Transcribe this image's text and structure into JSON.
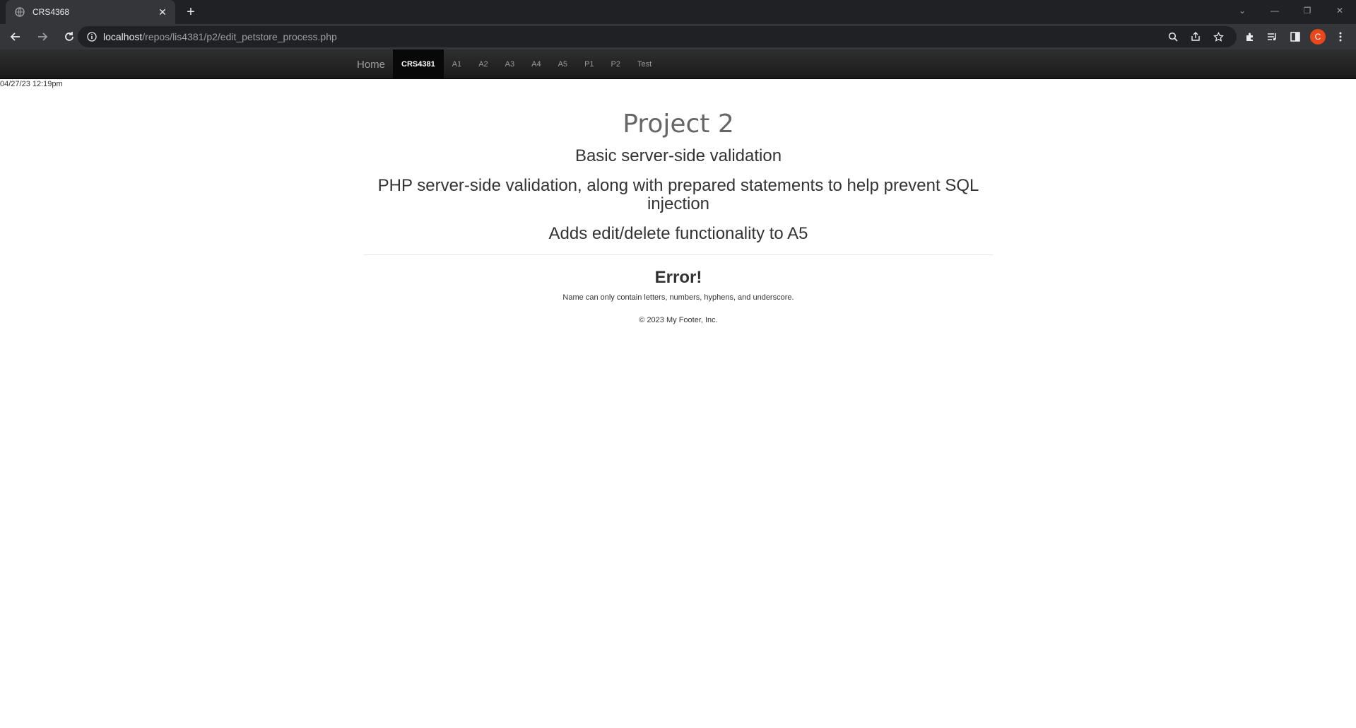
{
  "browser": {
    "tab_title": "CRS4368",
    "url_host": "localhost",
    "url_path": "/repos/lis4381/p2/edit_petstore_process.php",
    "profile_initial": "C",
    "icons": [
      "globe-icon",
      "close-icon",
      "plus-icon",
      "chevron-down-icon",
      "minimize-icon",
      "restore-icon",
      "back-icon",
      "forward-icon",
      "reload-icon",
      "info-icon",
      "zoom-icon",
      "share-icon",
      "star-icon",
      "extensions-icon",
      "media-icon",
      "side-panel-icon",
      "menu-icon"
    ]
  },
  "nav": {
    "brand": "Home",
    "items": [
      {
        "label": "CRS4381",
        "active": true
      },
      {
        "label": "A1"
      },
      {
        "label": "A2"
      },
      {
        "label": "A3"
      },
      {
        "label": "A4"
      },
      {
        "label": "A5"
      },
      {
        "label": "P1"
      },
      {
        "label": "P2"
      },
      {
        "label": "Test"
      }
    ]
  },
  "timestamp": "04/27/23 12:19pm",
  "main": {
    "title": "Project 2",
    "lines": [
      "Basic server-side validation",
      "PHP server-side validation, along with prepared statements to help prevent SQL injection",
      "Adds edit/delete functionality to A5"
    ],
    "error_heading": "Error!",
    "error_message": "Name can only contain letters, numbers, hyphens, and underscore.",
    "footer": "© 2023 My Footer, Inc."
  },
  "colors": {
    "chrome_dark": "#202124",
    "chrome_toolbar": "#35363a",
    "nav_bg": "#222222",
    "nav_active": "#080808",
    "avatar": "#e8481b"
  }
}
